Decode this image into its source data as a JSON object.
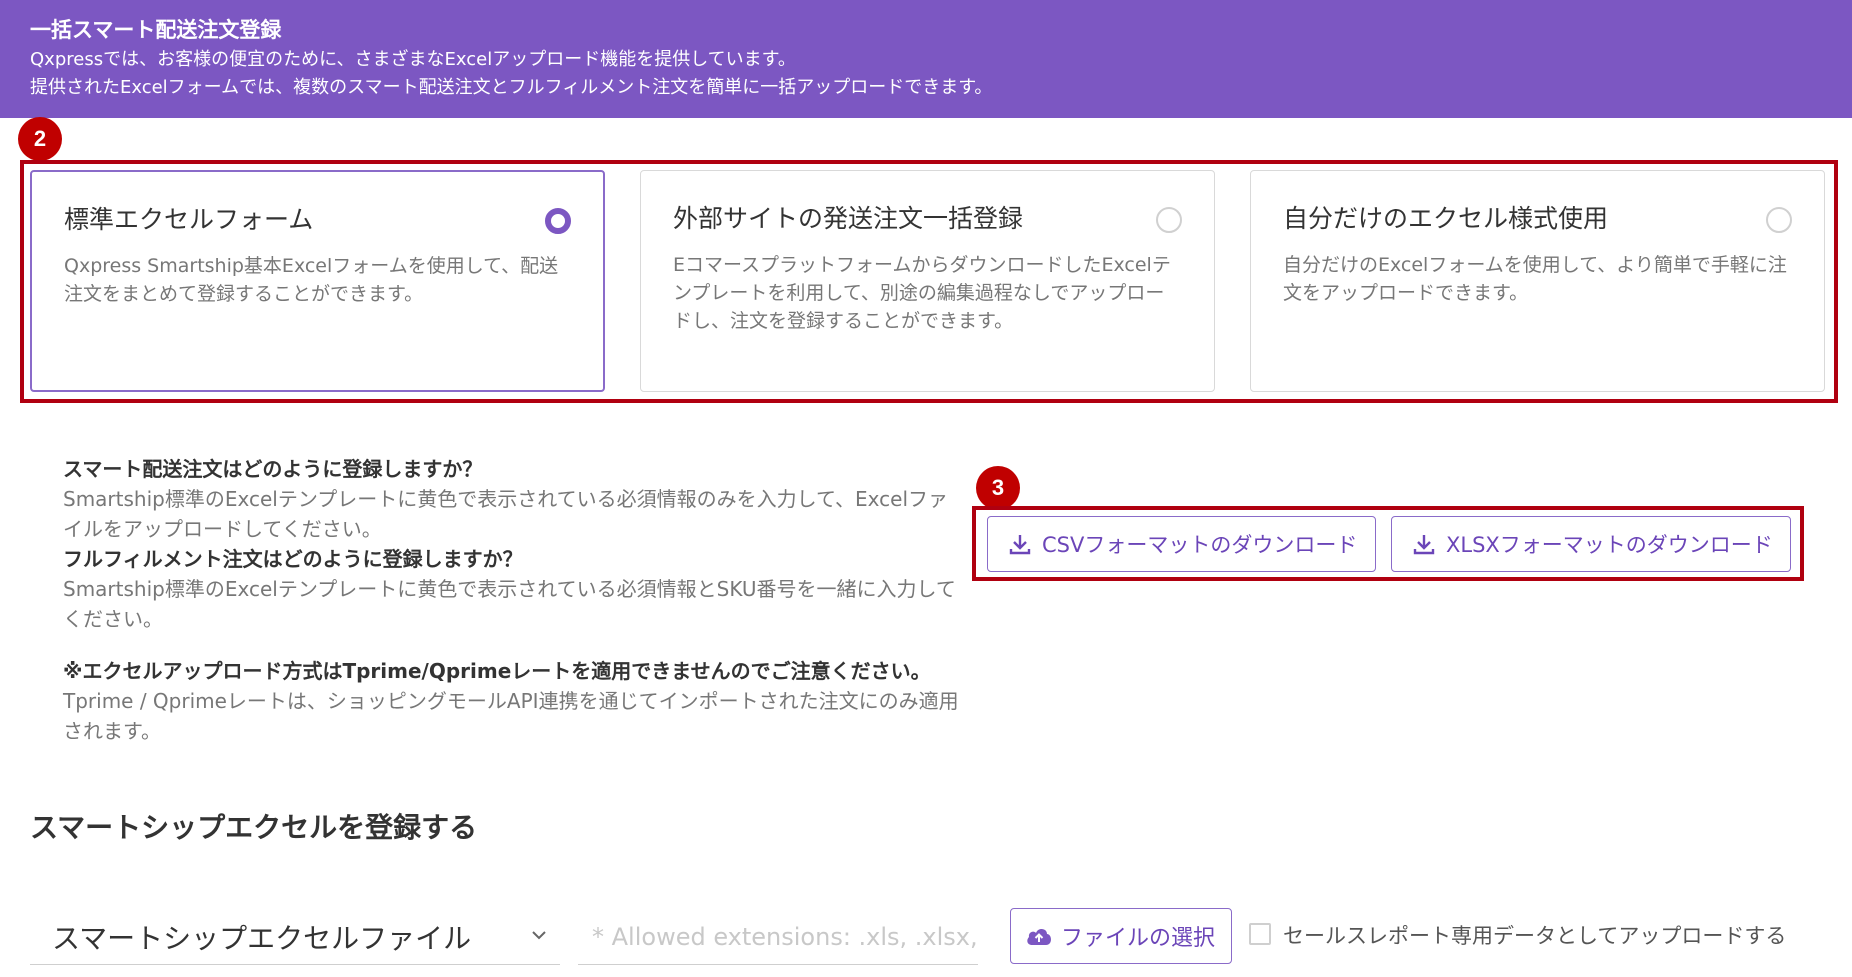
{
  "banner": {
    "title": "一括スマート配送注文登録",
    "line1": "Qxpressでは、お客様の便宜のために、さまざまなExcelアップロード機能を提供しています。",
    "line2": "提供されたExcelフォームでは、複数のスマート配送注文とフルフィルメント注文を簡単に一括アップロードできます。",
    "background_color": "#7c57c2"
  },
  "annotations": {
    "badge1": "2",
    "badge2": "3",
    "color": "#c00000"
  },
  "cards": [
    {
      "title": "標準エクセルフォーム",
      "desc": "Qxpress Smartship基本Excelフォームを使用して、配送注文をまとめて登録することができます。",
      "selected": true
    },
    {
      "title": "外部サイトの発送注文一括登録",
      "desc": "EコマースプラットフォームからダウンロードしたExcelテンプレートを利用して、別途の編集過程なしでアップロードし、注文を登録することができます。",
      "selected": false
    },
    {
      "title": "自分だけのエクセル様式使用",
      "desc": "自分だけのExcelフォームを使用して、より簡単で手軽に注文をアップロードできます。",
      "selected": false
    }
  ],
  "info": {
    "q1": "スマート配送注文はどのように登録しますか？",
    "a1": "Smartship標準のExcelテンプレートに黄色で表示されている必須情報のみを入力して、Excelファイルをアップロードしてください。",
    "q2": "フルフィルメント注文はどのように登録しますか？",
    "a2": "Smartship標準のExcelテンプレートに黄色で表示されている必須情報とSKU番号を一緒に入力してください。",
    "note": "※エクセルアップロード方式はTprime/Qprimeレートを適用できませんのでご注意ください。",
    "note_detail": "Tprime / Qprimeレートは、ショッピングモールAPI連携を通じてインポートされた注文にのみ適用されます。"
  },
  "downloads": {
    "csv_label": "CSVフォーマットのダウンロード",
    "xlsx_label": "XLSXフォーマットのダウンロード",
    "icon": "download-icon"
  },
  "register": {
    "title": "スマートシップエクセルを登録する",
    "select_value": "スマートシップエクセルファイル",
    "ext_placeholder": "* Allowed extensions: .xls, .xlsx, .",
    "file_button": "ファイルの選択",
    "checkbox_label": "セールスレポート専用データとしてアップロードする",
    "accent_color": "#7c57c2"
  }
}
